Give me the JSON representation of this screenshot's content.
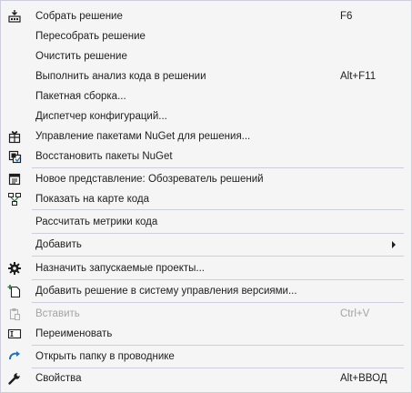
{
  "menu": {
    "items": [
      {
        "label": "Собрать решение",
        "shortcut": "F6",
        "icon": "build-solution-icon"
      },
      {
        "label": "Пересобрать решение"
      },
      {
        "label": "Очистить решение"
      },
      {
        "label": "Выполнить анализ кода в решении",
        "shortcut": "Alt+F11"
      },
      {
        "label": "Пакетная сборка..."
      },
      {
        "label": "Диспетчер конфигураций..."
      },
      {
        "label": "Управление пакетами NuGet для решения...",
        "icon": "nuget-package-icon"
      },
      {
        "label": "Восстановить пакеты NuGet",
        "icon": "restore-packages-icon"
      },
      {
        "label": "Новое представление: Обозреватель решений",
        "icon": "new-view-icon"
      },
      {
        "label": "Показать на карте кода",
        "icon": "code-map-icon"
      },
      {
        "label": "Рассчитать метрики кода"
      },
      {
        "label": "Добавить",
        "submenu": true
      },
      {
        "label": "Назначить запускаемые проекты...",
        "icon": "gear-icon"
      },
      {
        "label": "Добавить решение в систему управления версиями...",
        "icon": "add-source-control-icon"
      },
      {
        "label": "Вставить",
        "shortcut": "Ctrl+V",
        "disabled": true,
        "icon": "paste-icon"
      },
      {
        "label": "Переименовать",
        "icon": "rename-icon"
      },
      {
        "label": "Открыть папку в проводнике",
        "icon": "open-folder-arrow-icon"
      },
      {
        "label": "Свойства",
        "shortcut": "Alt+ВВОД",
        "icon": "wrench-icon"
      }
    ]
  }
}
